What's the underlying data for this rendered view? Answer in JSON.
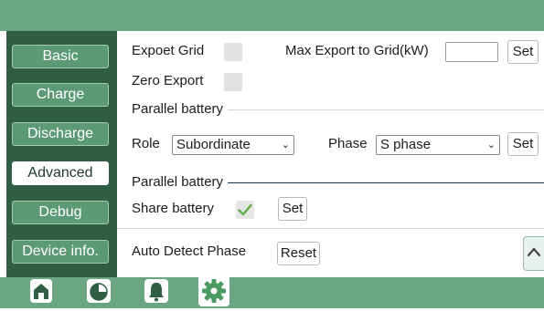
{
  "sidebar": {
    "items": [
      {
        "label": "Basic"
      },
      {
        "label": "Charge"
      },
      {
        "label": "Discharge"
      },
      {
        "label": "Advanced"
      },
      {
        "label": "Debug"
      },
      {
        "label": "Device info."
      }
    ],
    "active": "Advanced"
  },
  "main": {
    "expoet_grid_label": "Expoet Grid",
    "max_export_label": "Max Export to Grid(kW)",
    "max_export_value": "",
    "set_label": "Set",
    "zero_export_label": "Zero Export",
    "parallel_battery_title": "Parallel battery",
    "role_label": "Role",
    "role_value": "Subordinate",
    "phase_label": "Phase",
    "phase_value": "S phase",
    "parallel_battery_title_2": "Parallel battery",
    "share_battery_label": "Share battery",
    "share_battery_checked": true,
    "auto_detect_label": "Auto Detect Phase",
    "reset_label": "Reset"
  },
  "bottom_nav": {
    "icons": [
      "home-icon",
      "pie-chart-icon",
      "bell-icon",
      "gear-icon"
    ],
    "active": "gear-icon"
  },
  "colors": {
    "bar": "#6aa682",
    "sidebar_bg": "#2f5e45",
    "sidebar_btn": "#5c9a75",
    "check": "#5fb04a"
  }
}
